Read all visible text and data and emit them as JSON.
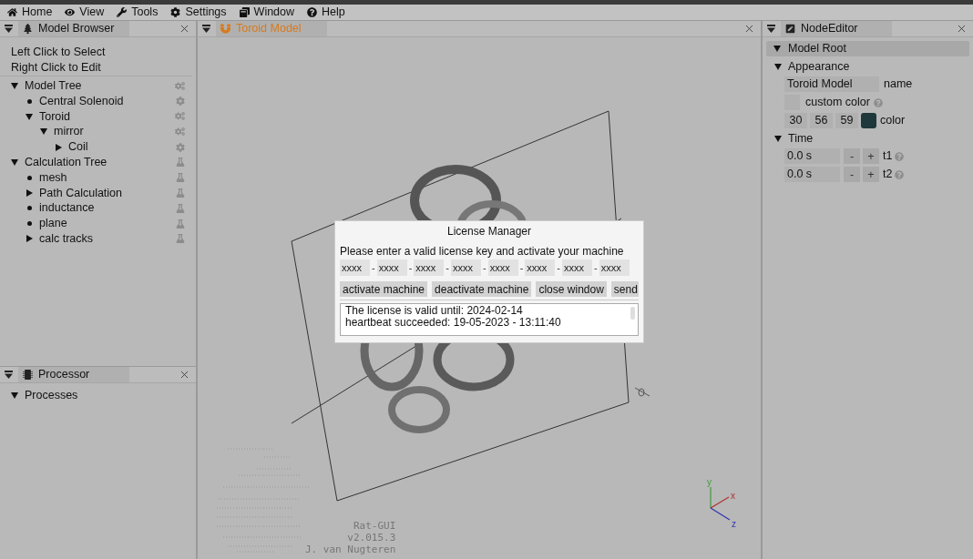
{
  "menu": [
    {
      "label": "Home",
      "kind": "home"
    },
    {
      "label": "View",
      "kind": "view"
    },
    {
      "label": "Tools",
      "kind": "tools"
    },
    {
      "label": "Settings",
      "kind": "settings"
    },
    {
      "label": "Window",
      "kind": "window"
    },
    {
      "label": "Help",
      "kind": "help"
    }
  ],
  "model_browser": {
    "title": "Model Browser",
    "hints": [
      "Left Click to Select",
      "Right Click to Edit"
    ],
    "tree": [
      {
        "label": "Model Tree",
        "kind": "model_group",
        "expanded": true,
        "children": [
          {
            "label": "Central Solenoid",
            "kind": "model_part"
          },
          {
            "label": "Toroid",
            "kind": "model_group",
            "expanded": true,
            "children": [
              {
                "label": "mirror",
                "kind": "model_group",
                "expanded": true,
                "children": [
                  {
                    "label": "Coil",
                    "kind": "model_part",
                    "expanded": false
                  }
                ]
              }
            ]
          }
        ]
      },
      {
        "label": "Calculation Tree",
        "kind": "calculation",
        "expanded": true,
        "children": [
          {
            "label": "mesh",
            "kind": "calculation"
          },
          {
            "label": "Path Calculation",
            "kind": "calculation",
            "expanded": false
          },
          {
            "label": "inductance",
            "kind": "calculation"
          },
          {
            "label": "plane",
            "kind": "calculation"
          },
          {
            "label": "calc tracks",
            "kind": "calculation",
            "expanded": false
          }
        ]
      }
    ]
  },
  "processor": {
    "title": "Processor",
    "tree": [
      {
        "label": "Processes",
        "expanded": true
      }
    ]
  },
  "viewport": {
    "tab": "Toroid Model",
    "credits": [
      "Rat-GUI",
      "v2.015.3",
      "J. van Nugteren"
    ],
    "axes": [
      "y",
      "x",
      "z"
    ]
  },
  "license_dialog": {
    "title": "License Manager",
    "prompt": "Please enter a valid license key and activate your machine",
    "key_fields": [
      "xxxx",
      "xxxx",
      "xxxx",
      "xxxx",
      "xxxx",
      "xxxx",
      "xxxx",
      "xxxx"
    ],
    "separator": "-",
    "buttons": [
      "activate machine",
      "deactivate machine",
      "close window",
      "send"
    ],
    "log": [
      "The license is valid until: 2024-02-14",
      "heartbeat succeeded: 19-05-2023 - 13:11:40"
    ]
  },
  "node_editor": {
    "title": "NodeEditor",
    "root": "Model Root",
    "appearance": {
      "title": "Appearance",
      "name_value": "Toroid Model",
      "name_label": "name",
      "custom_color_label": "custom color",
      "custom_color": false,
      "rgb": [
        "30",
        "56",
        "59"
      ],
      "color": "#1e383b",
      "color_label": "color"
    },
    "time": {
      "title": "Time",
      "rows": [
        {
          "value": "0.0 s",
          "minus": "-",
          "plus": "+",
          "label": "t1"
        },
        {
          "value": "0.0 s",
          "minus": "-",
          "plus": "+",
          "label": "t2"
        }
      ]
    }
  }
}
